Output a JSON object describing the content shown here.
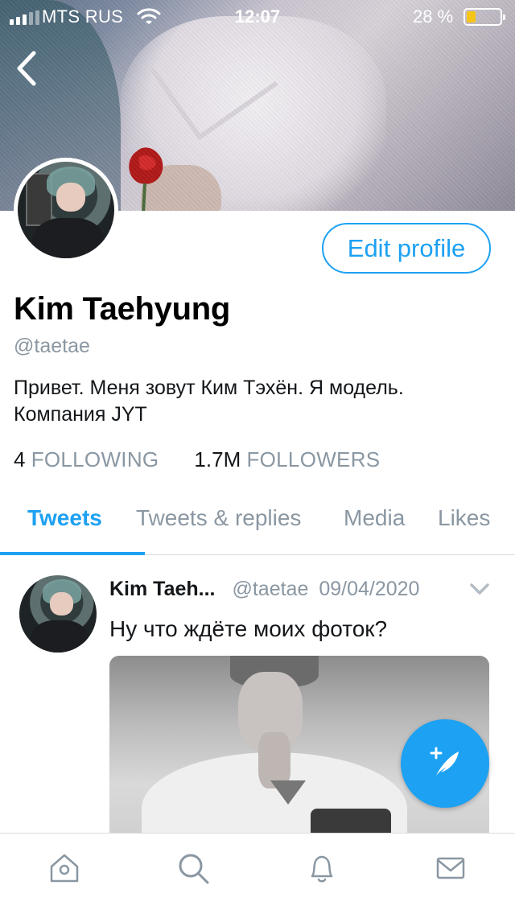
{
  "status_bar": {
    "carrier": "MTS RUS",
    "time": "12:07",
    "battery_percent": "28 %",
    "battery_level": 0.28,
    "battery_color": "#f5c518"
  },
  "nav": {
    "back_icon": "chevron-left-icon"
  },
  "profile": {
    "display_name": "Kim Taehyung",
    "handle": "@taetae",
    "bio_line1": "Привет. Меня зовут Ким Тэхён. Я модель.",
    "bio_line2": "Компания JYT",
    "edit_profile_label": "Edit profile",
    "following_count": "4",
    "following_label": "FOLLOWING",
    "followers_count": "1.7M",
    "followers_label": "FOLLOWERS"
  },
  "tabs": [
    {
      "label": "Tweets",
      "active": true
    },
    {
      "label": "Tweets & replies",
      "active": false
    },
    {
      "label": "Media",
      "active": false
    },
    {
      "label": "Likes",
      "active": false
    }
  ],
  "tweet": {
    "author_name": "Kim Taeh...",
    "author_handle": "@taetae",
    "date": "09/04/2020",
    "text": "Ну что ждёте моих фоток?",
    "menu_icon": "chevron-down-icon"
  },
  "compose": {
    "icon": "compose-feather-icon"
  },
  "bottom_nav": [
    {
      "icon": "home-icon"
    },
    {
      "icon": "search-icon"
    },
    {
      "icon": "bell-icon"
    },
    {
      "icon": "mail-icon"
    }
  ],
  "colors": {
    "accent": "#1da1f2",
    "secondary_text": "#8a97a2",
    "primary_text": "#14171a"
  }
}
